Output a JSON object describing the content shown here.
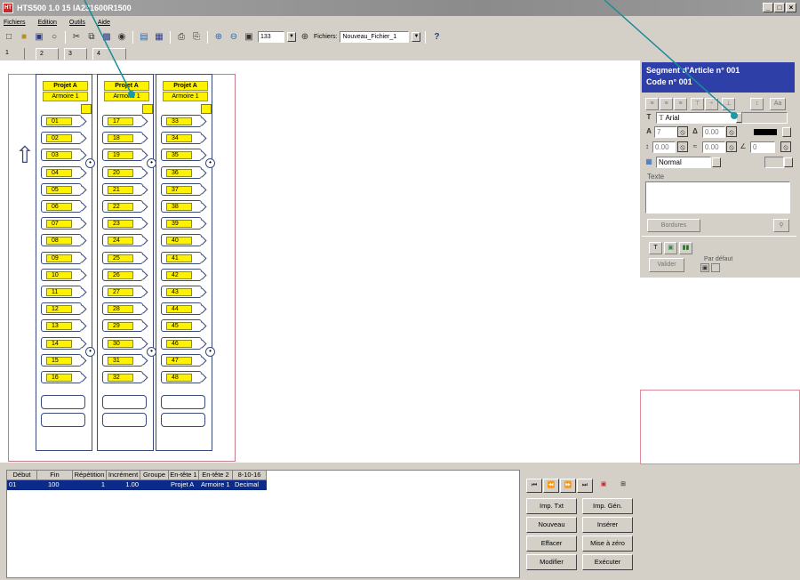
{
  "window": {
    "title": "HTS500  1.0  15 IA231600R1500",
    "buttons": [
      "_",
      "□",
      "×"
    ]
  },
  "menu": [
    "Fichiers",
    "Edition",
    "Outils",
    "Aide"
  ],
  "toolbar": {
    "zoom_value": "133",
    "files_label": "Fichiers:",
    "files_value": "Nouveau_Fichier_1",
    "help_glyph": "?"
  },
  "tabs": [
    "1",
    "2",
    "3",
    "4"
  ],
  "strips": [
    {
      "project": "Projet A",
      "cabinet": "Armoire 1",
      "numbers": [
        "01",
        "02",
        "03",
        "04",
        "05",
        "06",
        "07",
        "08",
        "09",
        "10",
        "11",
        "12",
        "13",
        "14",
        "15",
        "16"
      ]
    },
    {
      "project": "Projet A",
      "cabinet": "Armoire 1",
      "numbers": [
        "17",
        "18",
        "19",
        "20",
        "21",
        "22",
        "23",
        "24",
        "25",
        "26",
        "27",
        "28",
        "29",
        "30",
        "31",
        "32"
      ]
    },
    {
      "project": "Projet A",
      "cabinet": "Armoire 1",
      "numbers": [
        "33",
        "34",
        "35",
        "36",
        "37",
        "38",
        "39",
        "40",
        "41",
        "42",
        "43",
        "44",
        "45",
        "46",
        "47",
        "48"
      ]
    }
  ],
  "panel": {
    "segment_title": "Segment d'Article n° 001",
    "code_title": "Code n° 001",
    "font_name": "Arial",
    "font_size": "7",
    "spacing_a": "0.00",
    "offset_x": "0.00",
    "offset_y": "0.00",
    "angle": "0",
    "style": "Normal",
    "text_label": "Texte",
    "borders_label": "Bordures",
    "validate_label": "Valider",
    "default_label": "Par défaut",
    "tab_t": "T",
    "color_black": "#000000"
  },
  "table": {
    "columns": [
      "Début",
      "Fin",
      "Répétition",
      "Incrément",
      "Groupe",
      "En-tête 1",
      "En-tête 2",
      "8-10-16"
    ],
    "rows": [
      [
        "01",
        "100",
        "1",
        "1.00",
        "",
        "Projet A",
        "Armoire 1",
        "Decimal"
      ]
    ]
  },
  "buttons": {
    "imp_txt": "Imp. Txt",
    "imp_gen": "Imp. Gén.",
    "nouveau": "Nouveau",
    "inserer": "Insérer",
    "effacer": "Effacer",
    "reset": "Mise à zéro",
    "modifier": "Modifier",
    "executer": "Exécuter"
  },
  "colors": {
    "label_yellow": "#fff200",
    "panel_header": "#2e3fa8",
    "selection": "#0b2a8a",
    "callout": "#1a8a9a"
  }
}
